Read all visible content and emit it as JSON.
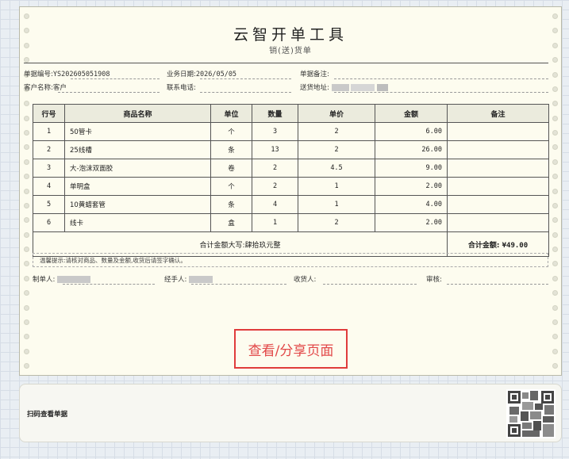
{
  "doc": {
    "title": "云智开单工具",
    "subtitle": "销(送)货单"
  },
  "header": {
    "doc_no_label": "单据编号:",
    "doc_no": "YS202605051908",
    "date_label": "业务日期:",
    "date": "2026/05/05",
    "remark_label": "单据备注:",
    "customer_label": "客户名称:",
    "customer": "客户",
    "phone_label": "联系电话:",
    "address_label": "送货地址:"
  },
  "table": {
    "columns": [
      "行号",
      "商品名称",
      "单位",
      "数量",
      "单价",
      "金额",
      "备注"
    ],
    "rows": [
      {
        "no": "1",
        "name": "50管卡",
        "unit": "个",
        "qty": "3",
        "price": "2",
        "amount": "6.00",
        "note": ""
      },
      {
        "no": "2",
        "name": "25线槽",
        "unit": "条",
        "qty": "13",
        "price": "2",
        "amount": "26.00",
        "note": ""
      },
      {
        "no": "3",
        "name": "大-泡沫双面胶",
        "unit": "卷",
        "qty": "2",
        "price": "4.5",
        "amount": "9.00",
        "note": ""
      },
      {
        "no": "4",
        "name": "单明盒",
        "unit": "个",
        "qty": "2",
        "price": "1",
        "amount": "2.00",
        "note": ""
      },
      {
        "no": "5",
        "name": "10黄蜡套管",
        "unit": "条",
        "qty": "4",
        "price": "1",
        "amount": "4.00",
        "note": ""
      },
      {
        "no": "6",
        "name": "线卡",
        "unit": "盒",
        "qty": "1",
        "price": "2",
        "amount": "2.00",
        "note": ""
      }
    ],
    "total_caps": "合计金额大写:肆拾玖元整",
    "total_label": "合计金额:",
    "total_value": "¥49.00"
  },
  "notice": "温馨提示:请核对商品、数量及金额,收货后请签字确认。",
  "signatures": {
    "maker_label": "制单人:",
    "handler_label": "经手人:",
    "receiver_label": "收货人:",
    "reviewer_label": "审核:"
  },
  "share_button": "查看/分享页面",
  "footer": {
    "scan_text": "扫码查看单据"
  }
}
